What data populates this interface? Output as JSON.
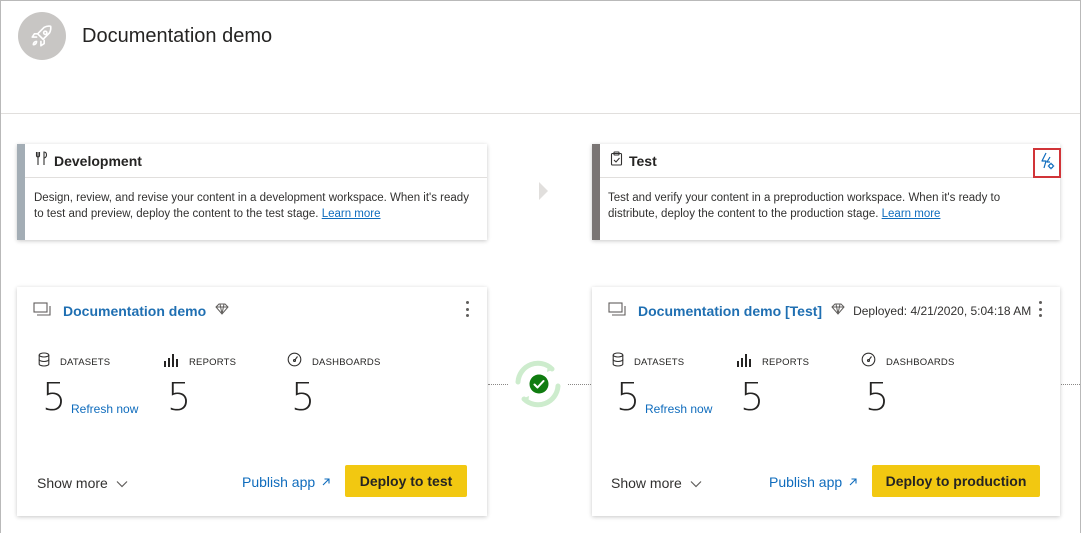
{
  "header": {
    "workspace_title": "Documentation demo",
    "avatar_icon": "rocket-icon"
  },
  "stages": [
    {
      "name": "Development",
      "icon": "tools-icon",
      "accent": "#a3adb5",
      "desc": "Design, review, and revise your content in a development workspace. When it's ready to test and preview, deploy the content to the test stage.",
      "learn_more": "Learn more"
    },
    {
      "name": "Test",
      "icon": "clipboard-check-icon",
      "accent": "#7a7574",
      "desc": "Test and verify your content in a preproduction workspace. When it's ready to distribute, deploy the content to the production stage.",
      "learn_more": "Learn more",
      "settings_icon": "deployment-rules-icon"
    }
  ],
  "workspaces": [
    {
      "name": "Documentation demo",
      "deployed": "",
      "premium_icon": "diamond-icon",
      "metrics": [
        {
          "label": "DATASETS",
          "count": "5",
          "icon": "database-icon"
        },
        {
          "label": "REPORTS",
          "count": "5",
          "icon": "bar-chart-icon"
        },
        {
          "label": "DASHBOARDS",
          "count": "5",
          "icon": "gauge-icon"
        }
      ],
      "refresh": "Refresh now",
      "show_more": "Show more",
      "publish": "Publish app",
      "deploy": "Deploy to test"
    },
    {
      "name": "Documentation demo [Test]",
      "deployed": "Deployed: 4/21/2020, 5:04:18 AM",
      "premium_icon": "diamond-icon",
      "metrics": [
        {
          "label": "DATASETS",
          "count": "5",
          "icon": "database-icon"
        },
        {
          "label": "REPORTS",
          "count": "5",
          "icon": "bar-chart-icon"
        },
        {
          "label": "DASHBOARDS",
          "count": "5",
          "icon": "gauge-icon"
        }
      ],
      "refresh": "Refresh now",
      "show_more": "Show more",
      "publish": "Publish app",
      "deploy": "Deploy to production"
    }
  ],
  "compare": {
    "icon": "sync-check-icon",
    "status_color": "#107c10"
  },
  "colors": {
    "accent_yellow": "#f2c811",
    "link_blue": "#0f6cbd",
    "alert_red": "#d13438"
  }
}
